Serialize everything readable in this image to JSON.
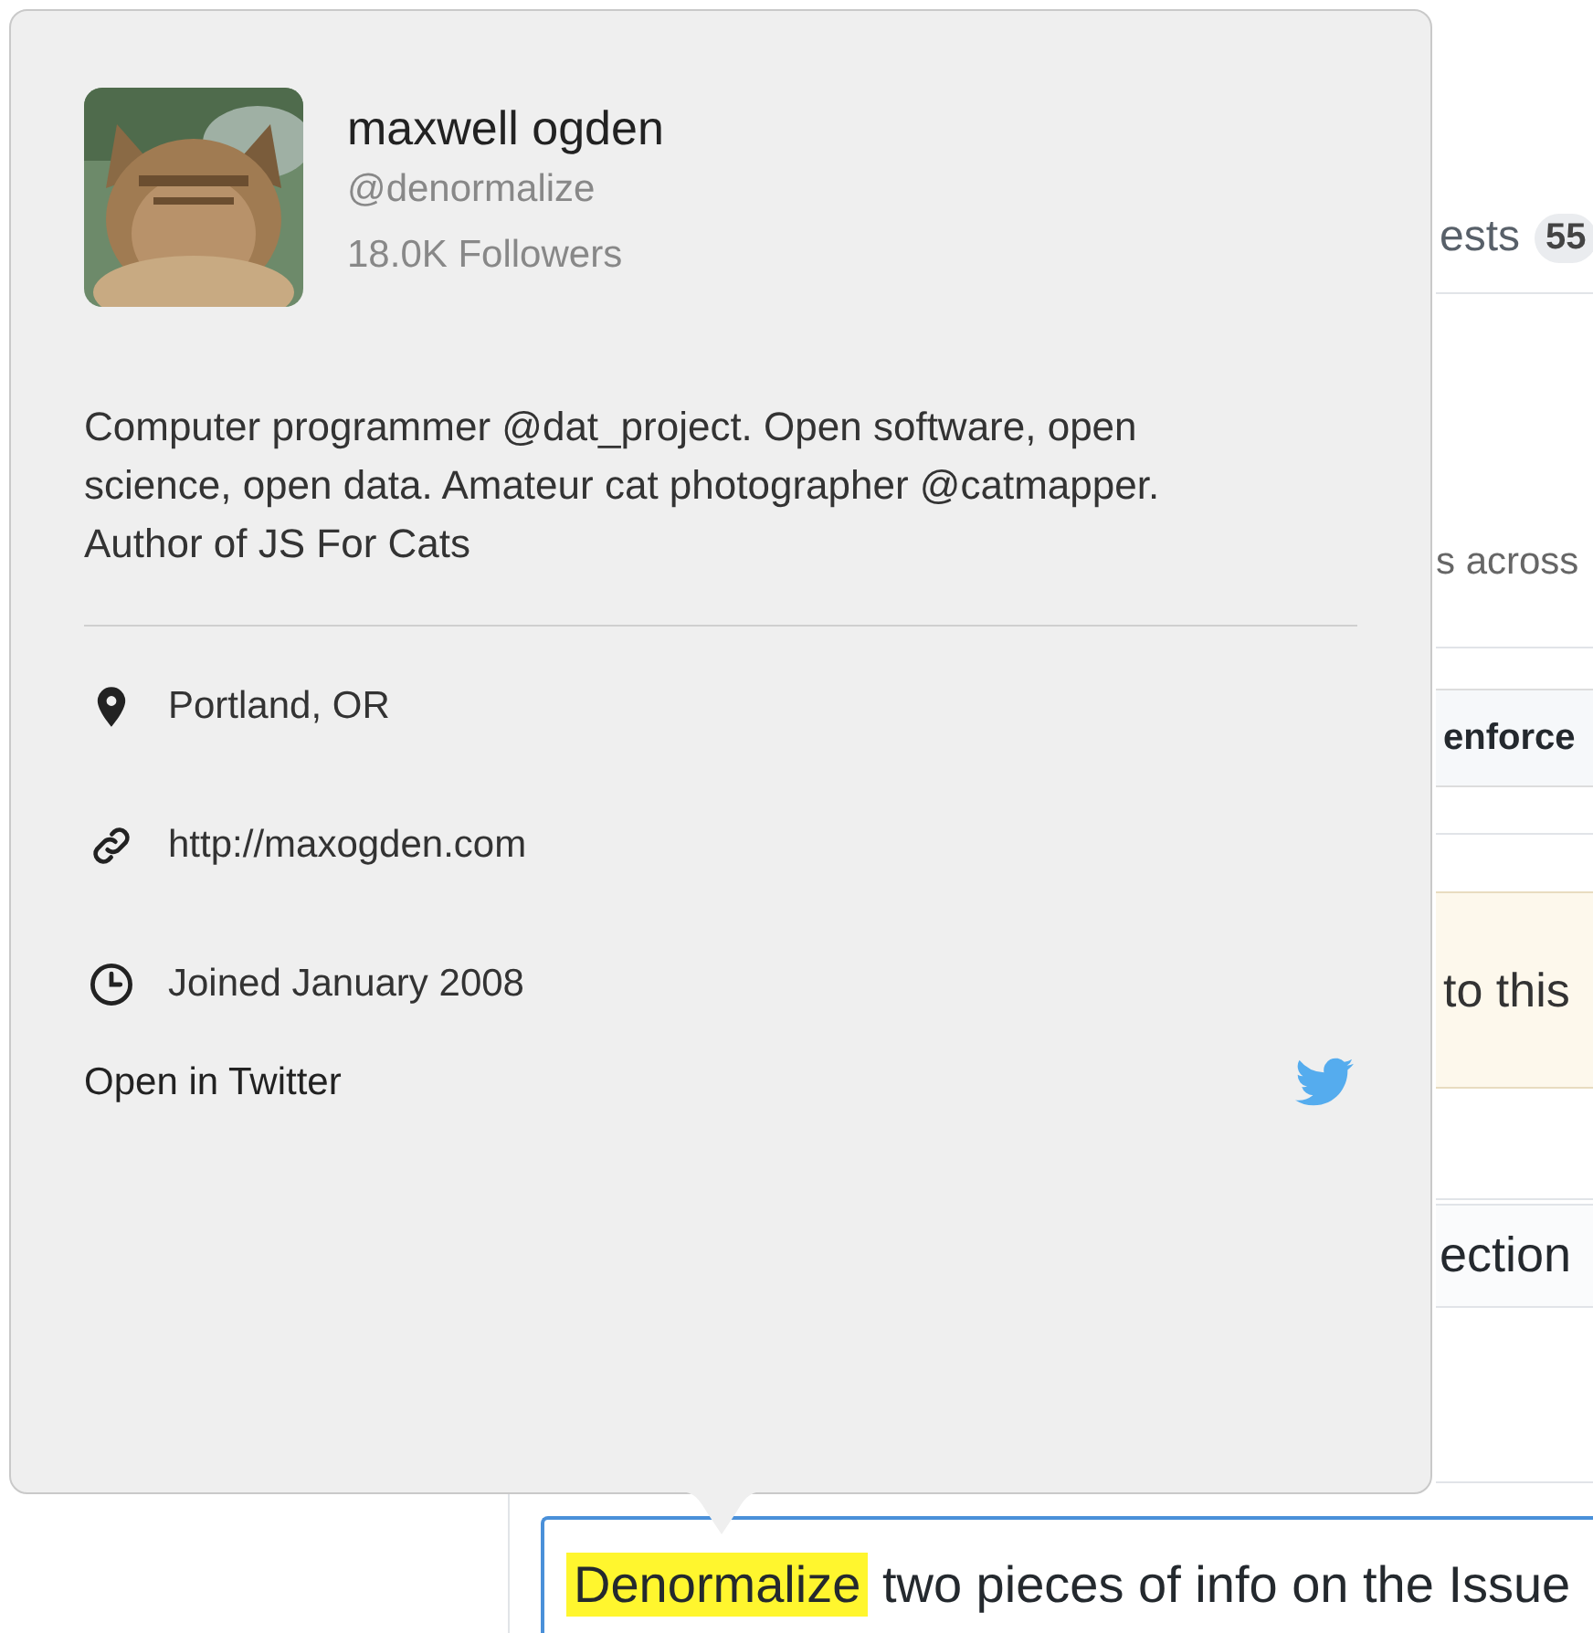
{
  "background": {
    "tab_fragment": "ests",
    "tab_count": "55",
    "text_fragment": "s across",
    "bar_fragment": "enforce",
    "notice_fragment": "to this",
    "heading_fragment": "ection"
  },
  "editor": {
    "highlighted": "Denormalize",
    "text": " two pieces of info on the Issue"
  },
  "popover": {
    "name": "maxwell ogden",
    "handle": "@denormalize",
    "followers": "18.0K Followers",
    "bio": "Computer programmer @dat_project. Open software, open science, open data. Amateur cat photographer @catmapper. Author of JS For Cats",
    "details": [
      {
        "kind": "location",
        "text": "Portland, OR"
      },
      {
        "kind": "link",
        "text": "http://maxogden.com"
      },
      {
        "kind": "joined",
        "text": "Joined January 2008"
      }
    ],
    "open_link": "Open in Twitter"
  }
}
